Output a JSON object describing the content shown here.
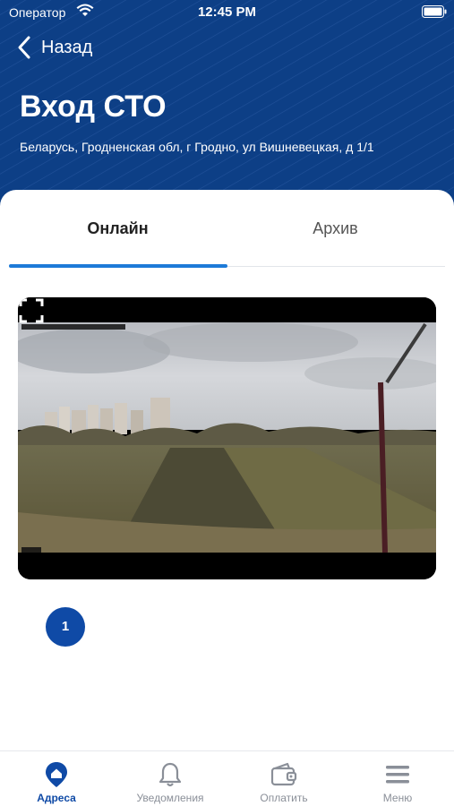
{
  "status_bar": {
    "carrier": "Оператор",
    "time": "12:45 PM"
  },
  "header": {
    "back_label": "Назад",
    "title": "Вход СТО",
    "address": "Беларусь, Гродненская обл, г Гродно, ул Вишневецкая, д 1/1"
  },
  "tabs": [
    {
      "label": "Онлайн",
      "active": true
    },
    {
      "label": "Архив",
      "active": false
    }
  ],
  "video": {
    "timestamp_overlay": "31-03-2023 12:45:51",
    "icon": "fullscreen-icon"
  },
  "pagination": {
    "current": "1"
  },
  "bottom_nav": [
    {
      "label": "Адреса",
      "icon": "location-home-icon",
      "active": true
    },
    {
      "label": "Уведомления",
      "icon": "bell-icon",
      "active": false
    },
    {
      "label": "Оплатить",
      "icon": "wallet-icon",
      "active": false
    },
    {
      "label": "Меню",
      "icon": "menu-icon",
      "active": false
    }
  ],
  "colors": {
    "header_bg": "#0d3f86",
    "accent": "#1d7ad8",
    "active_nav": "#0f4aa6",
    "inactive_nav": "#8a8f98"
  }
}
